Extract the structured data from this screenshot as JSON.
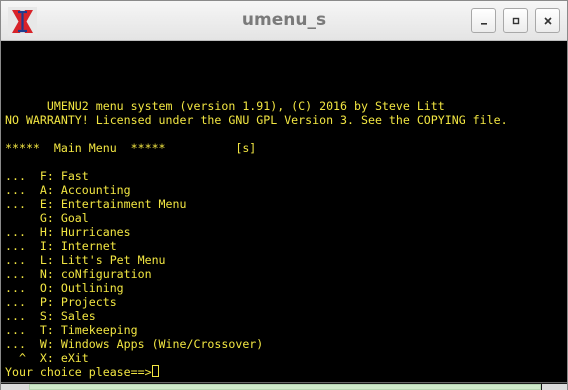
{
  "window": {
    "title": "umenu_s",
    "icon": "x-logo-icon",
    "buttons": [
      "minimize-icon",
      "maximize-icon",
      "close-icon"
    ]
  },
  "terminal": {
    "colors": {
      "background": "#000000",
      "text": "#f2e642"
    },
    "header_line1": "      UMENU2 menu system (version 1.91), (C) 2016 by Steve Litt",
    "header_line2": "NO WARRANTY! Licensed under the GNU GPL Version 3. See the COPYING file.",
    "menu_title": "*****  Main Menu  *****          [s]",
    "menu_items": [
      "...  F: Fast",
      "...  A: Accounting",
      "...  E: Entertainment Menu",
      "     G: Goal",
      "...  H: Hurricanes",
      "...  I: Internet",
      "...  L: Litt's Pet Menu",
      "...  N: coNfiguration",
      "...  O: Outlining",
      "...  P: Projects",
      "...  S: Sales",
      "...  T: Timekeeping",
      "...  W: Windows Apps (Wine/Crossover)",
      "  ^  X: eXit"
    ],
    "prompt": "Your choice please==>"
  }
}
